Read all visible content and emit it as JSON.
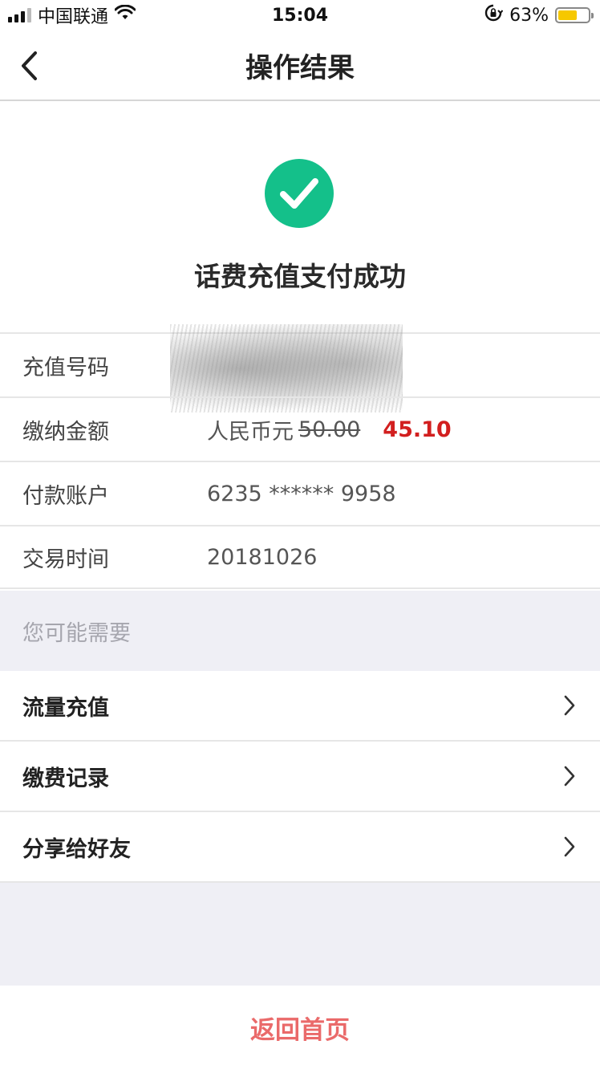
{
  "status_bar": {
    "carrier": "中国联通",
    "time": "15:04",
    "battery_percent": "63%",
    "battery_level": 0.63,
    "icons": [
      "signal-icon",
      "wifi-icon",
      "rotation-lock-icon",
      "battery-icon"
    ]
  },
  "nav": {
    "title": "操作结果",
    "back_icon": "chevron-left-icon"
  },
  "result": {
    "icon": "check-circle-icon",
    "icon_color": "#14c08a",
    "message": "话费充值支付成功"
  },
  "details": {
    "phone_label": "充值号码",
    "amount_label": "缴纳金额",
    "amount_currency": "人民币元",
    "amount_original": "50.00",
    "amount_actual": "45.10",
    "account_label": "付款账户",
    "account_value": "6235 ****** 9958",
    "time_label": "交易时间",
    "time_value": "20181026"
  },
  "suggestions": {
    "header": "您可能需要",
    "items": [
      {
        "label": "流量充值",
        "icon": "chevron-right-icon"
      },
      {
        "label": "缴费记录",
        "icon": "chevron-right-icon"
      },
      {
        "label": "分享给好友",
        "icon": "chevron-right-icon"
      }
    ]
  },
  "footer": {
    "home_button": "返回首页"
  },
  "colors": {
    "accent_green": "#14c08a",
    "price_red": "#d21f1f",
    "button_red": "#ea6a6a",
    "section_bg": "#efeff5"
  }
}
